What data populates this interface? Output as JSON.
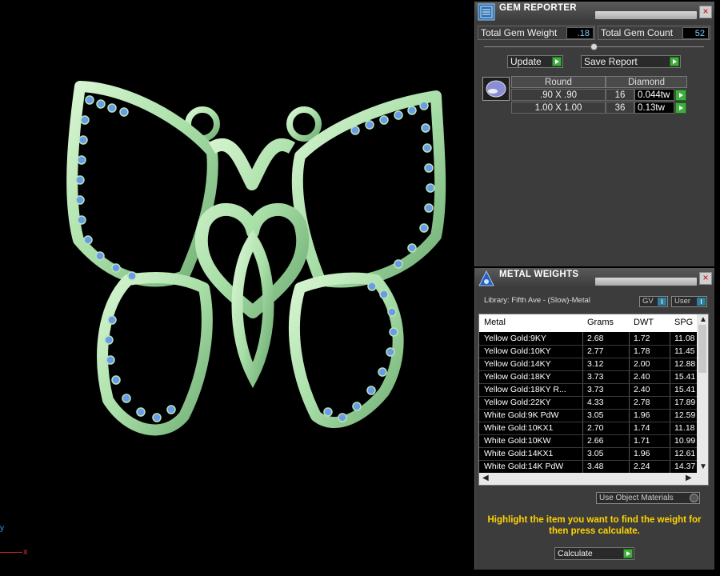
{
  "viewport": {
    "axis_y": "y",
    "axis_x": "x",
    "object": "butterfly-pendant"
  },
  "gem_reporter": {
    "title": "GEM REPORTER",
    "close": "×",
    "total_weight_label": "Total Gem Weight",
    "total_weight_value": ".18",
    "total_count_label": "Total Gem Count",
    "total_count_value": "52",
    "update_label": "Update",
    "save_label": "Save Report",
    "table": {
      "headers": [
        "Round",
        "Diamond"
      ],
      "rows": [
        {
          "size": ".90 X .90",
          "count": "16",
          "tw": "0.044tw"
        },
        {
          "size": "1.00 X 1.00",
          "count": "36",
          "tw": "0.13tw"
        }
      ]
    }
  },
  "metal_weights": {
    "title": "METAL WEIGHTS",
    "close": "×",
    "library": "Library: Fifth Ave - (Slow)-Metal",
    "gv_label": "GV",
    "user_label": "User",
    "columns": [
      "Metal",
      "Grams",
      "DWT",
      "SPG"
    ],
    "rows": [
      [
        "Yellow Gold:9KY",
        "2.68",
        "1.72",
        "11.08"
      ],
      [
        "Yellow Gold:10KY",
        "2.77",
        "1.78",
        "11.45"
      ],
      [
        "Yellow Gold:14KY",
        "3.12",
        "2.00",
        "12.88"
      ],
      [
        "Yellow Gold:18KY",
        "3.73",
        "2.40",
        "15.41"
      ],
      [
        "Yellow Gold:18KY R...",
        "3.73",
        "2.40",
        "15.41"
      ],
      [
        "Yellow Gold:22KY",
        "4.33",
        "2.78",
        "17.89"
      ],
      [
        "White Gold:9K PdW",
        "3.05",
        "1.96",
        "12.59"
      ],
      [
        "White Gold:10KX1",
        "2.70",
        "1.74",
        "11.18"
      ],
      [
        "White Gold:10KW",
        "2.66",
        "1.71",
        "10.99"
      ],
      [
        "White Gold:14KX1",
        "3.05",
        "1.96",
        "12.61"
      ],
      [
        "White Gold:14K PdW",
        "3.48",
        "2.24",
        "14.37"
      ]
    ],
    "use_object_materials": "Use Object Materials",
    "hint": "Highlight the item you want to find the weight for then press calculate.",
    "calculate_label": "Calculate"
  },
  "colors": {
    "metal": "#b6e6b4",
    "gem": "#6a9ae8",
    "hint": "#ffd400",
    "go": "#3fae3f"
  }
}
